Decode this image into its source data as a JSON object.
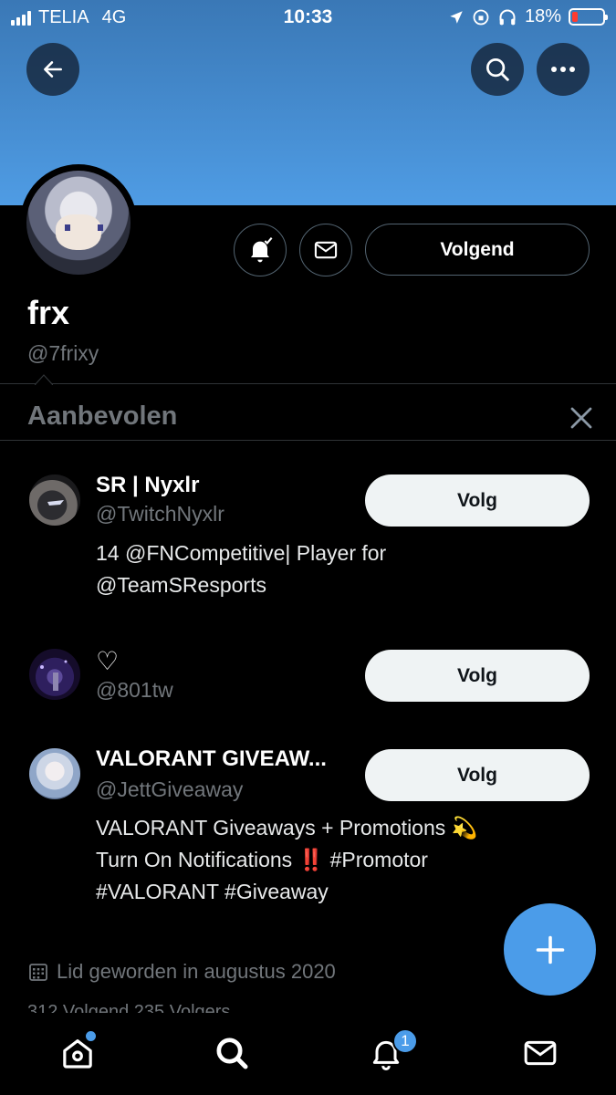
{
  "status_bar": {
    "carrier": "TELIA",
    "network": "4G",
    "time": "10:33",
    "battery": "18%"
  },
  "profile": {
    "display_name": "frx",
    "handle": "@7frixy",
    "following_label": "Volgend",
    "joined": "Lid geworden in augustus 2020",
    "stats_partial": "312 Volgend 235 Volgers"
  },
  "suggestions": {
    "title": "Aanbevolen",
    "items": [
      {
        "name": "SR | Nyxlr",
        "handle": "@TwitchNyxlr",
        "bio_lines": [
          "14 @FNCompetitive| Player for",
          "@TeamSResports"
        ],
        "follow_label": "Volg"
      },
      {
        "name": "♡",
        "handle": "@801tw",
        "bio_lines": [],
        "follow_label": "Volg"
      },
      {
        "name": "VALORANT GIVEAW...",
        "handle": "@JettGiveaway",
        "bio_lines": [
          "VALORANT Giveaways + Promotions 💫",
          "Turn On Notifications ‼️ #Promotor",
          "#VALORANT #Giveaway"
        ],
        "follow_label": "Volg"
      }
    ]
  },
  "tabbar": {
    "notification_count": "1"
  },
  "icons": [
    "back-arrow-icon",
    "search-icon",
    "more-icon",
    "bell-check-icon",
    "mail-icon",
    "close-icon",
    "calendar-icon",
    "plus-icon",
    "home-icon",
    "search-tab-icon",
    "bell-icon",
    "mail-tab-icon"
  ],
  "colors": {
    "banner": "#4f9ce4",
    "accent": "#4b9ce9",
    "background": "#000000",
    "secondary_text": "#71767b",
    "follow_button_bg": "#eff3f4"
  }
}
